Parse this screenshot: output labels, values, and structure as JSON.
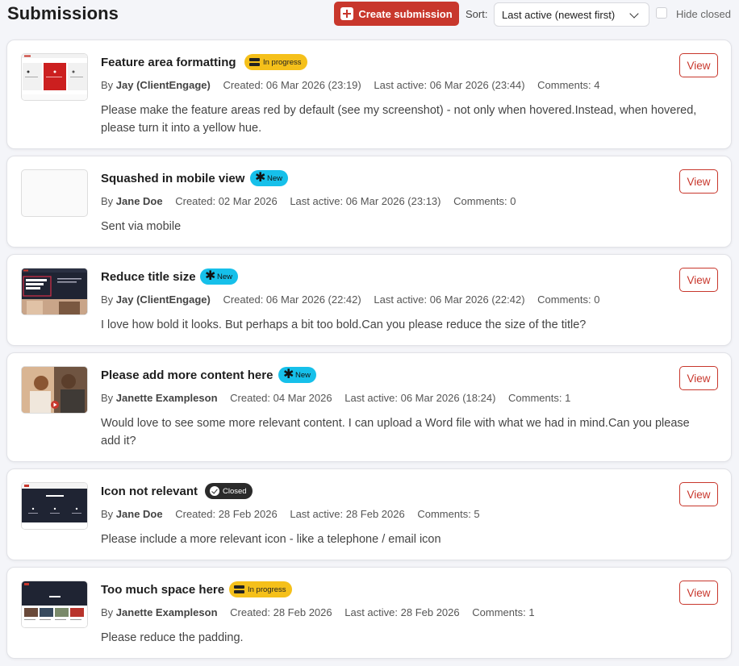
{
  "header": {
    "title": "Submissions",
    "create_label": "Create submission",
    "sort_label": "Sort:",
    "sort_value": "Last active (newest first)",
    "hide_closed_label": "Hide closed",
    "hide_closed_checked": false
  },
  "colors": {
    "accent": "#c8372c",
    "in_progress": "#f5c01a",
    "new": "#16c0ea",
    "closed": "#2a2a2a"
  },
  "submissions": [
    {
      "title": "Feature area formatting",
      "status": "In progress",
      "status_icon": "server-icon",
      "author": "Jay (ClientEngage)",
      "created": "Created: 06 Mar 2026 (23:19)",
      "last_active": "Last active: 06 Mar 2026 (23:44)",
      "comments": "Comments: 4",
      "description": "Please make the feature areas red by default (see my screenshot) - not only when hovered.Instead, when hovered, please turn it into a yellow hue.",
      "view_label": "View"
    },
    {
      "title": "Squashed in mobile view",
      "status": "New",
      "status_icon": "asterisk-icon",
      "author": "Jane Doe",
      "created": "Created: 02 Mar 2026",
      "last_active": "Last active: 06 Mar 2026 (23:13)",
      "comments": "Comments: 0",
      "description": "Sent via mobile",
      "view_label": "View"
    },
    {
      "title": "Reduce title size",
      "status": "New",
      "status_icon": "asterisk-icon",
      "author": "Jay (ClientEngage)",
      "created": "Created: 06 Mar 2026 (22:42)",
      "last_active": "Last active: 06 Mar 2026 (22:42)",
      "comments": "Comments: 0",
      "description": "I love how bold it looks. But perhaps a bit too bold.Can you please reduce the size of the title?",
      "view_label": "View"
    },
    {
      "title": "Please add more content here",
      "status": "New",
      "status_icon": "asterisk-icon",
      "author": "Janette Exampleson",
      "created": "Created: 04 Mar 2026",
      "last_active": "Last active: 06 Mar 2026 (18:24)",
      "comments": "Comments: 1",
      "description": "Would love to see some more relevant content. I can upload a Word file with what we had in mind.Can you please add it?",
      "view_label": "View"
    },
    {
      "title": "Icon not relevant",
      "status": "Closed",
      "status_icon": "check-circle-icon",
      "author": "Jane Doe",
      "created": "Created: 28 Feb 2026",
      "last_active": "Last active: 28 Feb 2026",
      "comments": "Comments: 5",
      "description": "Please include a more relevant icon - like a telephone / email icon",
      "view_label": "View"
    },
    {
      "title": "Too much space here",
      "status": "In progress",
      "status_icon": "server-icon",
      "author": "Janette Exampleson",
      "created": "Created: 28 Feb 2026",
      "last_active": "Last active: 28 Feb 2026",
      "comments": "Comments: 1",
      "description": "Please reduce the padding.",
      "view_label": "View"
    }
  ]
}
